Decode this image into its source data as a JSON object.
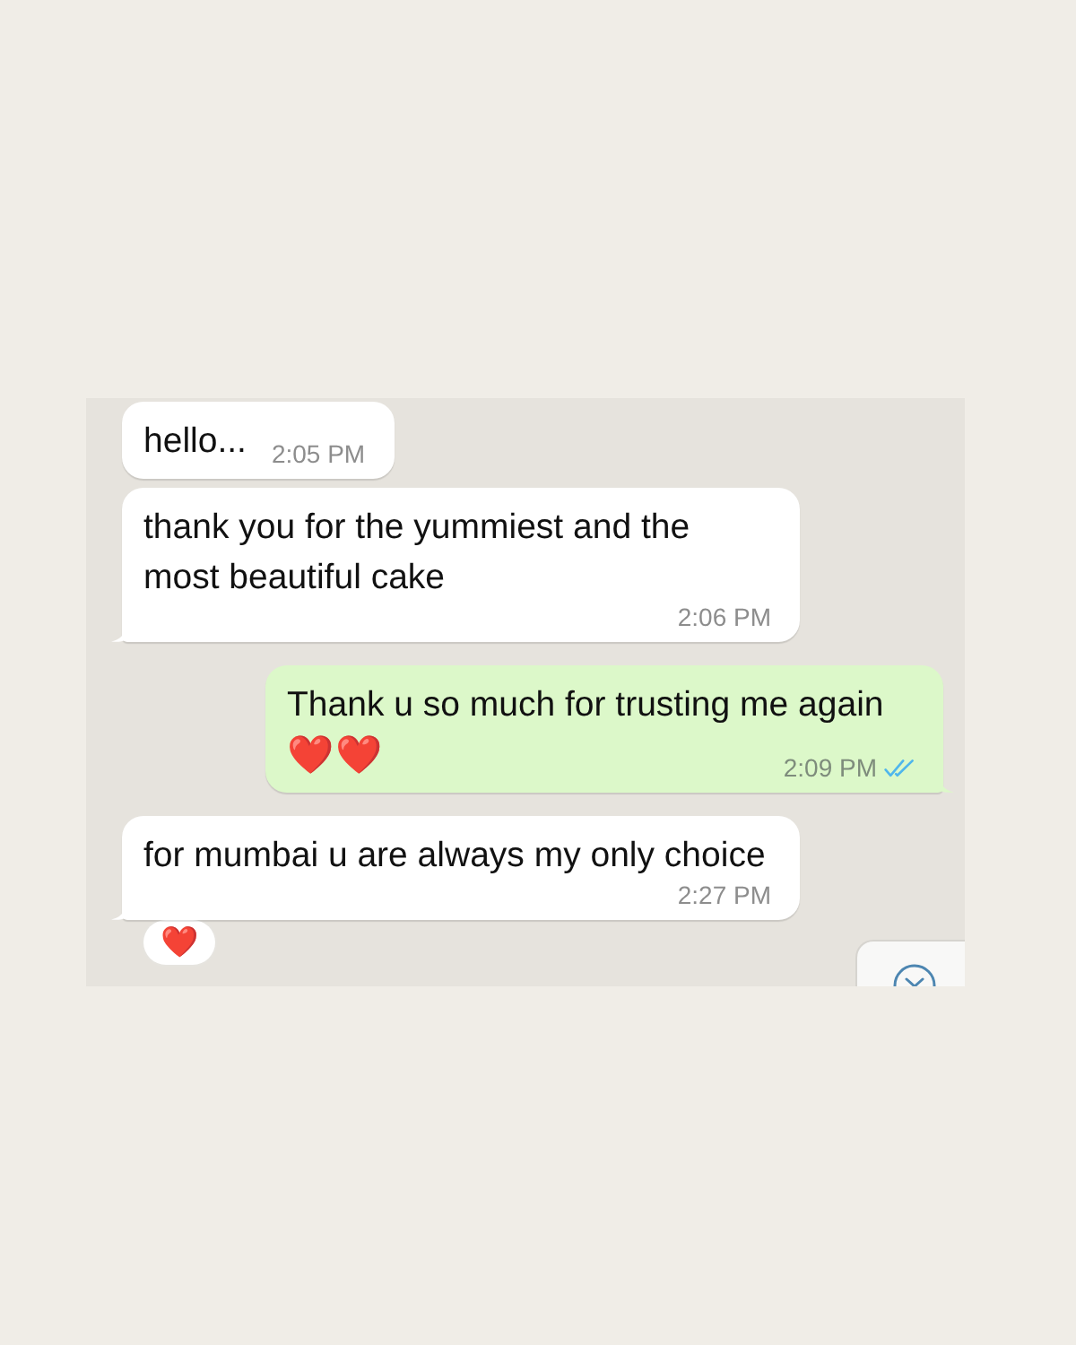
{
  "chat": {
    "messages": [
      {
        "kind": "incoming",
        "text": "hello...",
        "time": "2:05 PM"
      },
      {
        "kind": "incoming",
        "text": "thank you for the yummiest and the most beautiful cake",
        "time": "2:06 PM"
      },
      {
        "kind": "outgoing",
        "text": "Thank u so much for trusting me again",
        "emoji": "❤️❤️",
        "time": "2:09 PM",
        "read": true
      },
      {
        "kind": "incoming",
        "text": "for mumbai u are always my only choice",
        "time": "2:27 PM",
        "reaction": "❤️"
      }
    ]
  }
}
